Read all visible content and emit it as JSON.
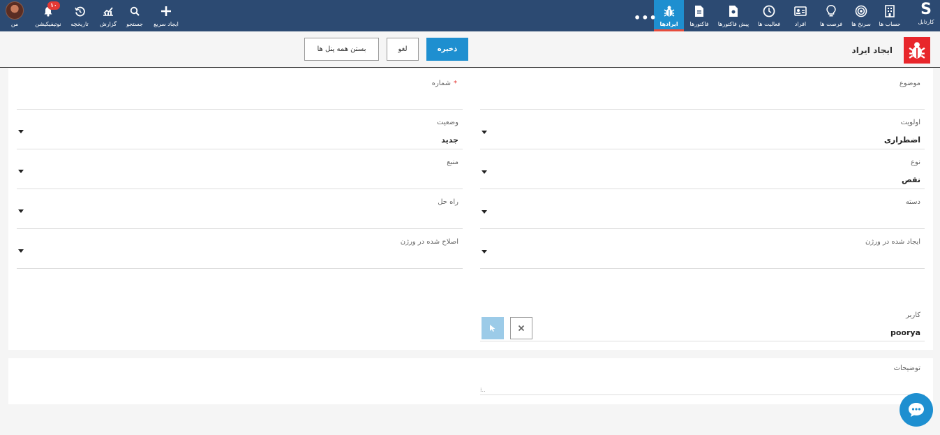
{
  "nav": {
    "brand_label": "کارتابل",
    "items": [
      {
        "label": "حساب ها",
        "icon": "building-icon"
      },
      {
        "label": "سرنخ ها",
        "icon": "target-icon"
      },
      {
        "label": "فرصت ها",
        "icon": "lightbulb-icon"
      },
      {
        "label": "افراد",
        "icon": "contact-card-icon"
      },
      {
        "label": "فعالیت ها",
        "icon": "clock-icon"
      },
      {
        "label": "پیش فاکتورها",
        "icon": "document-icon"
      },
      {
        "label": "فاکتورها",
        "icon": "invoice-icon"
      },
      {
        "label": "ایرادها",
        "icon": "bug-icon"
      }
    ],
    "left_items": [
      {
        "label": "ایجاد سریع",
        "icon": "plus-icon"
      },
      {
        "label": "جستجو",
        "icon": "search-icon"
      },
      {
        "label": "گزارش",
        "icon": "chart-icon"
      },
      {
        "label": "تاریخچه",
        "icon": "history-icon"
      },
      {
        "label": "نوتیفیکیشن",
        "icon": "bell-icon"
      },
      {
        "label": "من",
        "icon": "avatar"
      }
    ],
    "notification_count": "۱۰",
    "more": "•••"
  },
  "header": {
    "title": "ایجاد ایراد",
    "save": "ذخیره",
    "cancel": "لغو",
    "close_all": "بستن همه پنل ها"
  },
  "form": {
    "subject": {
      "label": "موضوع",
      "value": ""
    },
    "number": {
      "label": "شماره",
      "value": "",
      "required": "*"
    },
    "priority": {
      "label": "اولویت",
      "value": "اضطراری"
    },
    "status": {
      "label": "وضعیت",
      "value": "جدید"
    },
    "type": {
      "label": "نوع",
      "value": "نقص"
    },
    "source": {
      "label": "منبع",
      "value": ""
    },
    "category": {
      "label": "دسته",
      "value": ""
    },
    "resolution": {
      "label": "راه حل",
      "value": ""
    },
    "found_in_version": {
      "label": "ایجاد شده در ورژن",
      "value": ""
    },
    "fixed_in_version": {
      "label": "اصلاح شده در ورژن",
      "value": ""
    },
    "user": {
      "label": "کاربر",
      "value": "poorya"
    }
  },
  "description": {
    "label": "توضیحات",
    "value": ""
  },
  "colors": {
    "navbar": "#2c4a72",
    "accent": "#1e8fd0",
    "danger": "#e8262b"
  }
}
